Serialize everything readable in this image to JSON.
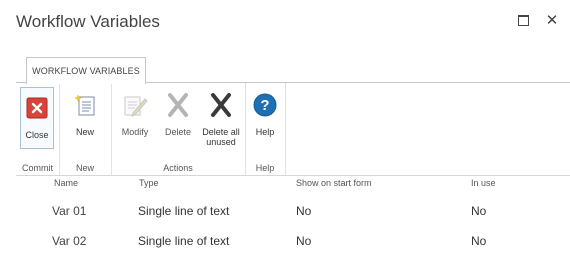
{
  "window": {
    "title": "Workflow Variables"
  },
  "ribbon": {
    "tab_label": "WORKFLOW VARIABLES",
    "groups": [
      {
        "label": "Commit",
        "buttons": [
          {
            "label": "Close",
            "icon": "close-icon"
          }
        ]
      },
      {
        "label": "New",
        "buttons": [
          {
            "label": "New",
            "icon": "new-document-icon"
          }
        ]
      },
      {
        "label": "Actions",
        "buttons": [
          {
            "label": "Modify",
            "icon": "edit-icon",
            "disabled": true
          },
          {
            "label": "Delete",
            "icon": "delete-icon",
            "disabled": true
          },
          {
            "label": "Delete all unused",
            "icon": "delete-all-icon",
            "disabled": false
          }
        ]
      },
      {
        "label": "Help",
        "buttons": [
          {
            "label": "Help",
            "icon": "help-icon"
          }
        ]
      }
    ]
  },
  "table": {
    "columns": [
      "Name",
      "Type",
      "Show on start form",
      "In use"
    ],
    "rows": [
      [
        "Var 01",
        "Single line of text",
        "No",
        "No"
      ],
      [
        "Var 02",
        "Single line of text",
        "No",
        "No"
      ]
    ]
  },
  "colors": {
    "close_icon_red": "#d9443a",
    "help_icon_blue": "#1f6fb5",
    "disabled_gray": "#b4b4b4",
    "delete_all_dark": "#3a3a3a"
  }
}
